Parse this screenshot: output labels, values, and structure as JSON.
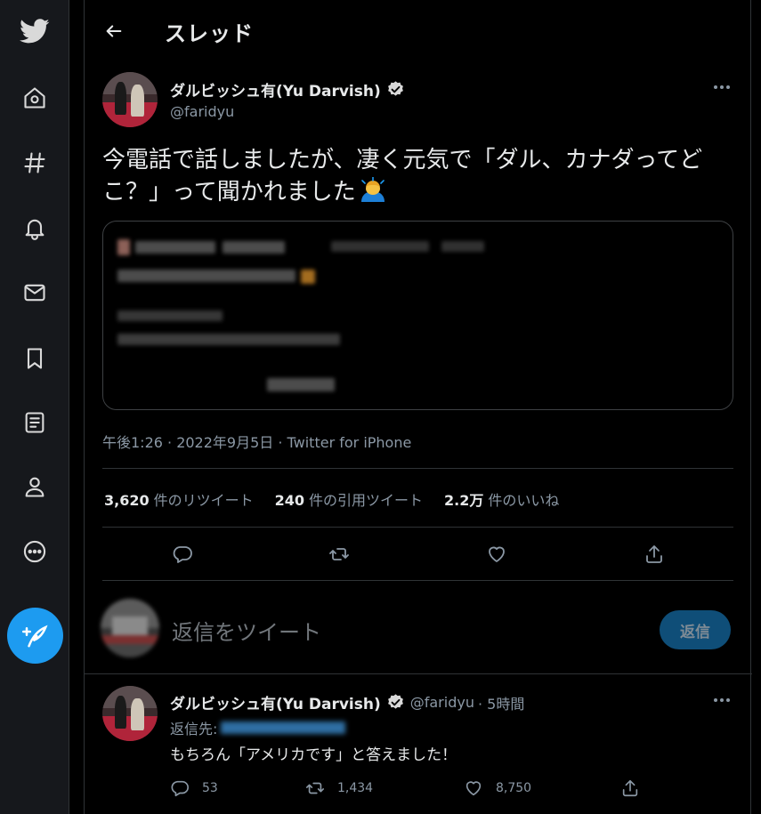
{
  "sidebar": {
    "items": [
      {
        "icon": "twitter-bird-icon"
      },
      {
        "icon": "home-icon"
      },
      {
        "icon": "explore-hashtag-icon"
      },
      {
        "icon": "notifications-bell-icon"
      },
      {
        "icon": "messages-envelope-icon"
      },
      {
        "icon": "bookmarks-icon"
      },
      {
        "icon": "lists-icon"
      },
      {
        "icon": "profile-icon"
      },
      {
        "icon": "more-circle-icon"
      }
    ],
    "compose_icon": "compose-tweet-icon",
    "accent_color": "#1d9bf0"
  },
  "header": {
    "title": "スレッド",
    "back_icon": "back-arrow-icon"
  },
  "main_tweet": {
    "display_name": "ダルビッシュ有(Yu Darvish)",
    "handle": "@faridyu",
    "text": "今電話で話しましたが、凄く元気で「ダル、カナダってどこ？」って聞かれました",
    "timestamp": "午後1:26 · 2022年9月5日 · Twitter for iPhone",
    "stats": {
      "retweets_count": "3,620",
      "retweets_label": "件のリツイート",
      "quotes_count": "240",
      "quotes_label": "件の引用ツイート",
      "likes_count": "2.2万",
      "likes_label": "件のいいね"
    }
  },
  "reply_box": {
    "placeholder": "返信をツイート",
    "button_label": "返信"
  },
  "reply_tweet": {
    "display_name": "ダルビッシュ有(Yu Darvish)",
    "handle": "@faridyu",
    "time": "· 5時間",
    "reply_to_label": "返信先:",
    "text": "もちろん「アメリカです」と答えました！",
    "replies": "53",
    "retweets": "1,434",
    "likes": "8,750"
  }
}
